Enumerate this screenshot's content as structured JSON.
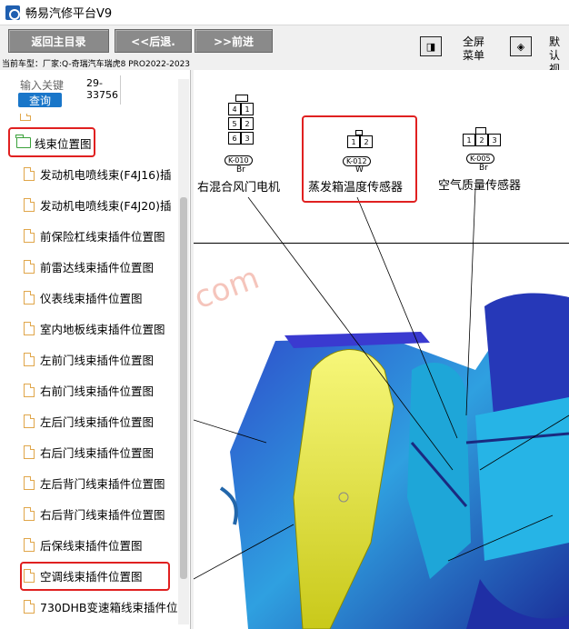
{
  "window": {
    "title": "畅易汽修平台V9"
  },
  "toolbar": {
    "back_main": "返回主目录",
    "back": "<<后退.",
    "forward": ">>前进",
    "fullscreen_line1": "全屏",
    "fullscreen_line2": "菜单",
    "default_line1": "默认",
    "default_line2": "视图"
  },
  "vehicle": {
    "info": "当前车型：厂家:Q-奇瑞汽车瑞虎8 PRO2022-2023"
  },
  "search": {
    "label": "输入关键",
    "button": "查询",
    "value": "29-33756"
  },
  "tree": {
    "folder_label": "线束位置图",
    "items": [
      "发动机电喷线束(F4J16)插",
      "发动机电喷线束(F4J20)插",
      "前保险杠线束插件位置图",
      "前雷达线束插件位置图",
      "仪表线束插件位置图",
      "室内地板线束插件位置图",
      "左前门线束插件位置图",
      "右前门线束插件位置图",
      "左后门线束插件位置图",
      "右后门线束插件位置图",
      "左后背门线束插件位置图",
      "右后背门线束插件位置图",
      "后保线束插件位置图",
      "空调线束插件位置图",
      "730DHB变速箱线束插件位"
    ]
  },
  "diagram": {
    "connectors": [
      {
        "code": "K-010",
        "color": "Br",
        "label": "右混合风门电机",
        "pins": [
          "4",
          "1",
          "5",
          "2",
          "6",
          "3"
        ]
      },
      {
        "code": "K-012",
        "color": "W",
        "label": "蒸发箱温度传感器",
        "pins": [
          "1",
          "2"
        ]
      },
      {
        "code": "K-005",
        "color": "Br",
        "label": "空气质量传感器",
        "pins": [
          "1",
          "2",
          "3"
        ]
      }
    ],
    "watermark": "com"
  }
}
